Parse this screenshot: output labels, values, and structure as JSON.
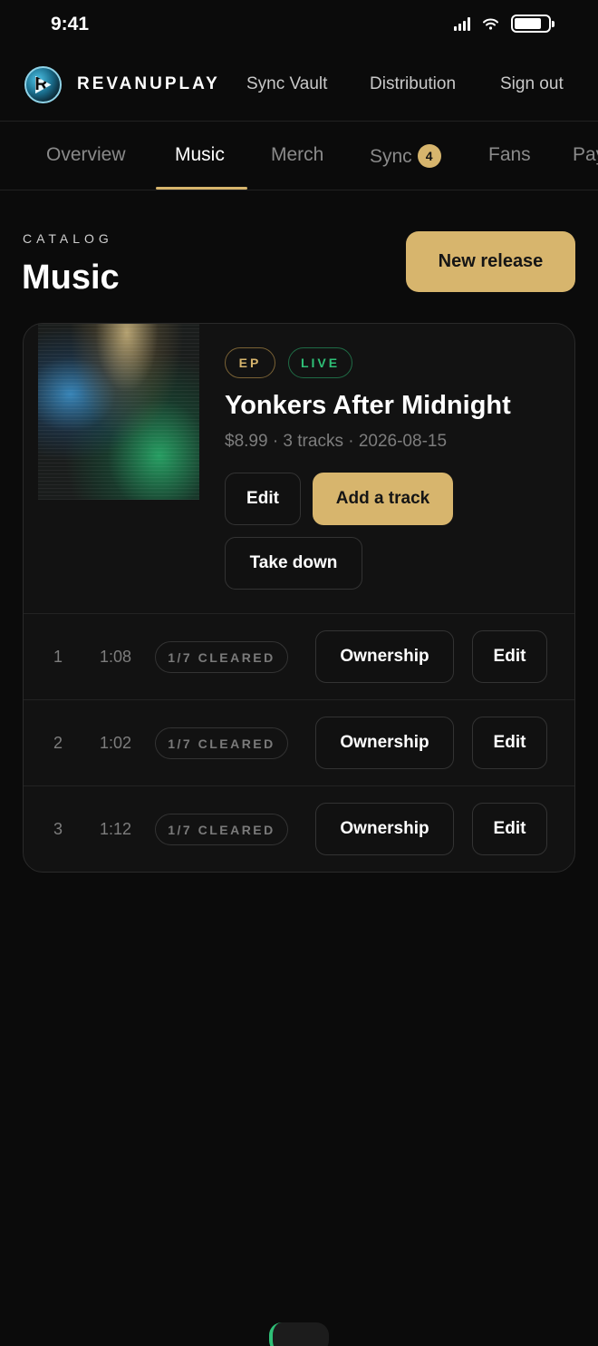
{
  "status_bar": {
    "time": "9:41"
  },
  "header": {
    "brand": "REVANUPLAY",
    "nav": [
      "Sync Vault",
      "Distribution",
      "Sign out"
    ]
  },
  "tabs": [
    {
      "label": "Overview"
    },
    {
      "label": "Music",
      "active": true
    },
    {
      "label": "Merch"
    },
    {
      "label": "Sync",
      "badge": "4"
    },
    {
      "label": "Fans"
    },
    {
      "label": "Pay"
    }
  ],
  "page": {
    "eyebrow": "CATALOG",
    "title": "Music",
    "new_release_label": "New release"
  },
  "release": {
    "type_badge": "EP",
    "status_badge": "LIVE",
    "title": "Yonkers After Midnight",
    "meta": "$8.99 · 3 tracks · 2026-08-15",
    "edit_label": "Edit",
    "add_track_label": "Add a track",
    "take_down_label": "Take down",
    "tracks": [
      {
        "number": "1",
        "duration": "1:08",
        "clearance": "1/7 CLEARED",
        "ownership_label": "Ownership",
        "edit_label": "Edit"
      },
      {
        "number": "2",
        "duration": "1:02",
        "clearance": "1/7 CLEARED",
        "ownership_label": "Ownership",
        "edit_label": "Edit"
      },
      {
        "number": "3",
        "duration": "1:12",
        "clearance": "1/7 CLEARED",
        "ownership_label": "Ownership",
        "edit_label": "Edit"
      }
    ]
  },
  "colors": {
    "accent": "#d7b56d",
    "live": "#2fc077",
    "background": "#0b0b0b"
  }
}
